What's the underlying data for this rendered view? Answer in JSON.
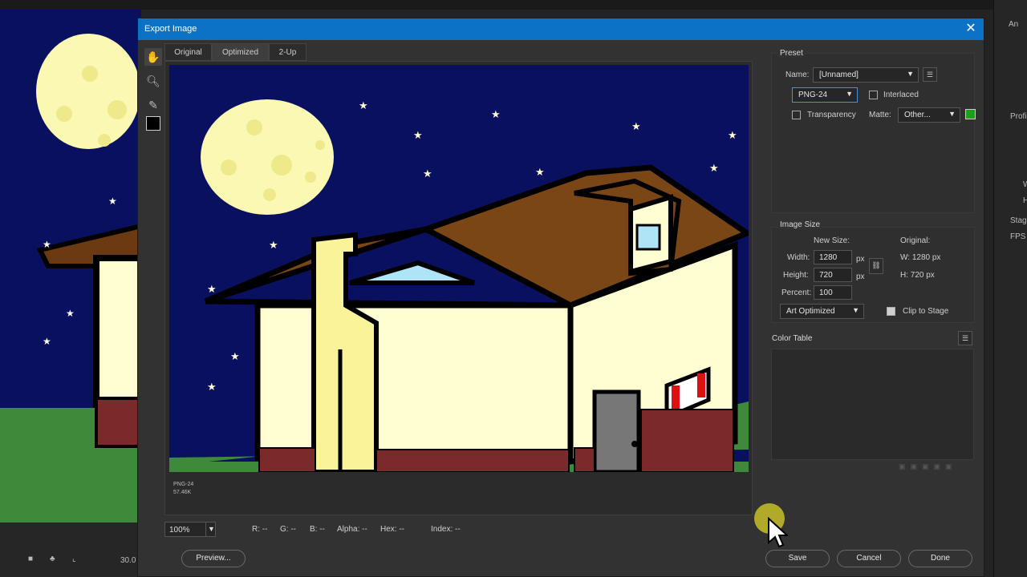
{
  "dialog": {
    "title": "Export Image"
  },
  "tabs": [
    {
      "label": "Original"
    },
    {
      "label": "Optimized",
      "active": true
    },
    {
      "label": "2-Up"
    }
  ],
  "tools": [
    "hand-icon",
    "zoom-icon",
    "eyedropper-icon",
    "color-swatch"
  ],
  "preview_info": {
    "format": "PNG-24",
    "size": "57.46K"
  },
  "zoom": {
    "value": "100%"
  },
  "readouts": {
    "r": "R: --",
    "g": "G: --",
    "b": "B: --",
    "alpha": "Alpha: --",
    "hex": "Hex: --",
    "index": "Index: --"
  },
  "buttons": {
    "preview": "Preview...",
    "save": "Save",
    "cancel": "Cancel",
    "done": "Done"
  },
  "preset": {
    "section": "Preset",
    "name_label": "Name:",
    "name_value": "[Unnamed]",
    "format": "PNG-24",
    "interlaced_label": "Interlaced",
    "interlaced": false,
    "transparency_label": "Transparency",
    "transparency": false,
    "matte_label": "Matte:",
    "matte_value": "Other...",
    "matte_color": "#1aa01a"
  },
  "image_size": {
    "section": "Image Size",
    "new_size_label": "New Size:",
    "original_label": "Original:",
    "width_label": "Width:",
    "width_value": "1280",
    "height_label": "Height:",
    "height_value": "720",
    "unit": "px",
    "percent_label": "Percent:",
    "percent_value": "100",
    "orig_w": "W:  1280 px",
    "orig_h": "H:  720 px",
    "quality": "Art Optimized",
    "clip_label": "Clip to Stage",
    "clip": true
  },
  "color_table": {
    "section": "Color Table"
  },
  "background_app": {
    "timeline_value": "30.0",
    "panel_labels": [
      "Profil",
      "W",
      "H",
      "Stage",
      "FPS"
    ]
  }
}
